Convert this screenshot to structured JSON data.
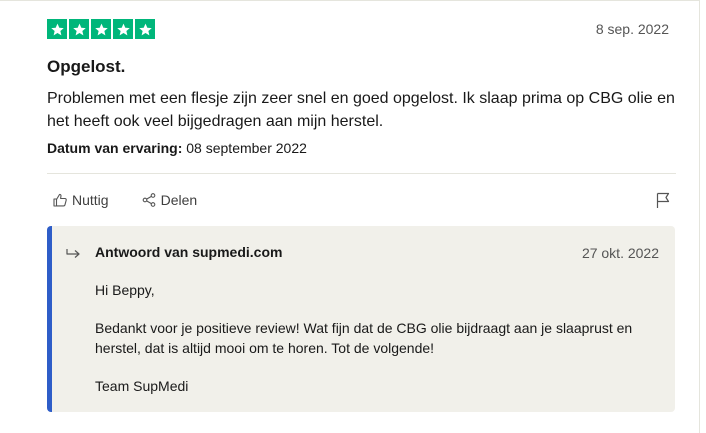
{
  "review": {
    "rating": 5,
    "rating_max": 5,
    "star_color": "#00b67a",
    "date": "8 sep. 2022",
    "title": "Opgelost.",
    "body": "Problemen met een flesje zijn zeer snel en goed opgelost. Ik slaap prima op CBG olie en het heeft ook veel bijgedragen aan mijn herstel.",
    "experience_label": "Datum van ervaring:",
    "experience_date": "08 september 2022"
  },
  "actions": {
    "useful_label": "Nuttig",
    "useful_icon": "thumbs-up-icon",
    "share_label": "Delen",
    "share_icon": "share-icon",
    "report_icon": "flag-icon"
  },
  "reply": {
    "icon": "reply-arrow-icon",
    "author": "Antwoord van supmedi.com",
    "date": "27 okt. 2022",
    "accent_color": "#2e5dc8",
    "greeting": "Hi Beppy,",
    "message": "Bedankt voor je positieve review! Wat fijn dat de CBG olie bijdraagt aan je slaaprust en herstel, dat is altijd mooi om te horen. Tot de volgende!",
    "signature": "Team SupMedi"
  }
}
